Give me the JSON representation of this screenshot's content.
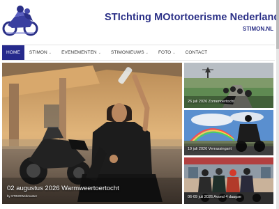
{
  "site": {
    "title": "STIchting MOtortoerisme Nederland",
    "subtitle": "STIMON.NL"
  },
  "nav": {
    "items": [
      {
        "label": "HOME",
        "active": true,
        "has_dropdown": false
      },
      {
        "label": "STIMON",
        "active": false,
        "has_dropdown": true
      },
      {
        "label": "EVENEMENTEN",
        "active": false,
        "has_dropdown": true
      },
      {
        "label": "STIMONIEUWS",
        "active": false,
        "has_dropdown": true
      },
      {
        "label": "FOTO",
        "active": false,
        "has_dropdown": true
      },
      {
        "label": "CONTACT",
        "active": false,
        "has_dropdown": false
      }
    ],
    "caret": "⌄"
  },
  "hero": {
    "title": "02 augustus 2026 Warmweertoertocht",
    "author": "by STIMOWebmaster"
  },
  "side_posts": [
    {
      "caption": "26 juli 2026 Zomertoertocht"
    },
    {
      "caption": "19 juli 2026 Verrassingsrit"
    },
    {
      "caption": "06-09 juli 2026 Avond 4 daagse"
    }
  ],
  "colors": {
    "brand": "#2a2f86",
    "nav_active": "#262a8c"
  },
  "icons": {
    "logo": "motorcycle-logo-icon",
    "dropdown": "chevron-down-icon"
  }
}
